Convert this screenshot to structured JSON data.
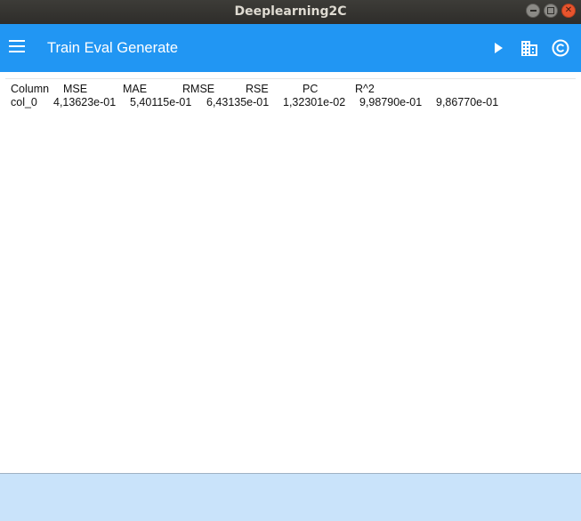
{
  "window": {
    "title": "Deeplearning2C"
  },
  "appbar": {
    "title": "Train Eval Generate",
    "actions": [
      "play-icon",
      "building-icon",
      "copyright-icon"
    ],
    "color": "#2196f3"
  },
  "table": {
    "headers": [
      "Column",
      "MSE",
      "MAE",
      "RMSE",
      "RSE",
      "PC",
      "R^2"
    ],
    "rows": [
      [
        "col_0",
        "4,13623e-01",
        "5,40115e-01",
        "6,43135e-01",
        "1,32301e-02",
        "9,98790e-01",
        "9,86770e-01"
      ]
    ]
  },
  "bottombar": {
    "color": "#c9e3fa"
  }
}
